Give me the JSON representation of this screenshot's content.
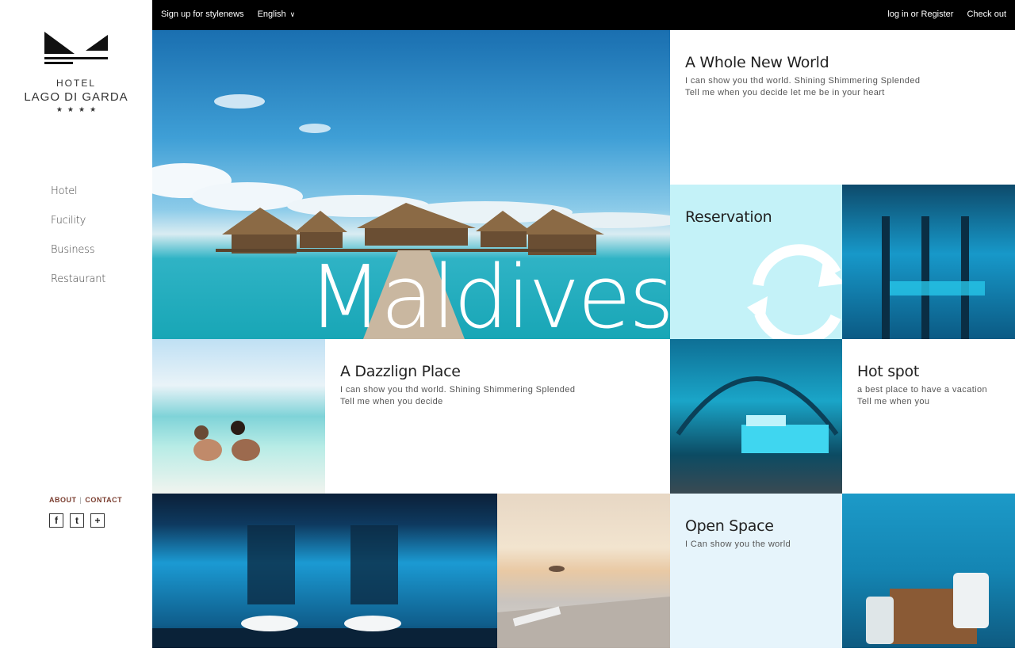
{
  "topbar": {
    "signup": "Sign up for stylenews",
    "language": "English",
    "login": "log in or Register",
    "checkout": "Check out"
  },
  "logo": {
    "line1": "HOTEL",
    "line2": "LAGO DI GARDA",
    "stars": "★★★★"
  },
  "nav": {
    "items": [
      {
        "label": "Hotel"
      },
      {
        "label": "Fucility"
      },
      {
        "label": "Business"
      },
      {
        "label": "Restaurant"
      }
    ]
  },
  "footer": {
    "about": "ABOUT",
    "separator": "|",
    "contact": "CONTACT",
    "social": [
      {
        "icon": "facebook-icon",
        "glyph": "f"
      },
      {
        "icon": "twitter-icon",
        "glyph": "t"
      },
      {
        "icon": "plus-icon",
        "glyph": "+"
      }
    ]
  },
  "hero": {
    "word": "Maldives"
  },
  "tiles": {
    "whole_new_world": {
      "title": "A Whole New World",
      "line1": "I can show you thd world. Shining Shimmering Splended",
      "line2": "Tell me when you decide let me be in your heart"
    },
    "reservation": {
      "title": "Reservation"
    },
    "dazzling": {
      "title": "A Dazzlign Place",
      "line1": "I can show you thd world. Shining Shimmering Splended",
      "line2": "Tell me when you decide"
    },
    "hot_spot": {
      "title": "Hot spot",
      "line1": "a best place to have a vacation",
      "line2": "Tell me when you"
    },
    "open_space": {
      "title": "Open Space",
      "line1": "I Can show you the world"
    }
  },
  "colors": {
    "topbar_bg": "#000000",
    "reservation_bg": "#c4f2f8",
    "open_space_bg": "#e6f4fb",
    "footer_link": "#7a3d2f"
  }
}
